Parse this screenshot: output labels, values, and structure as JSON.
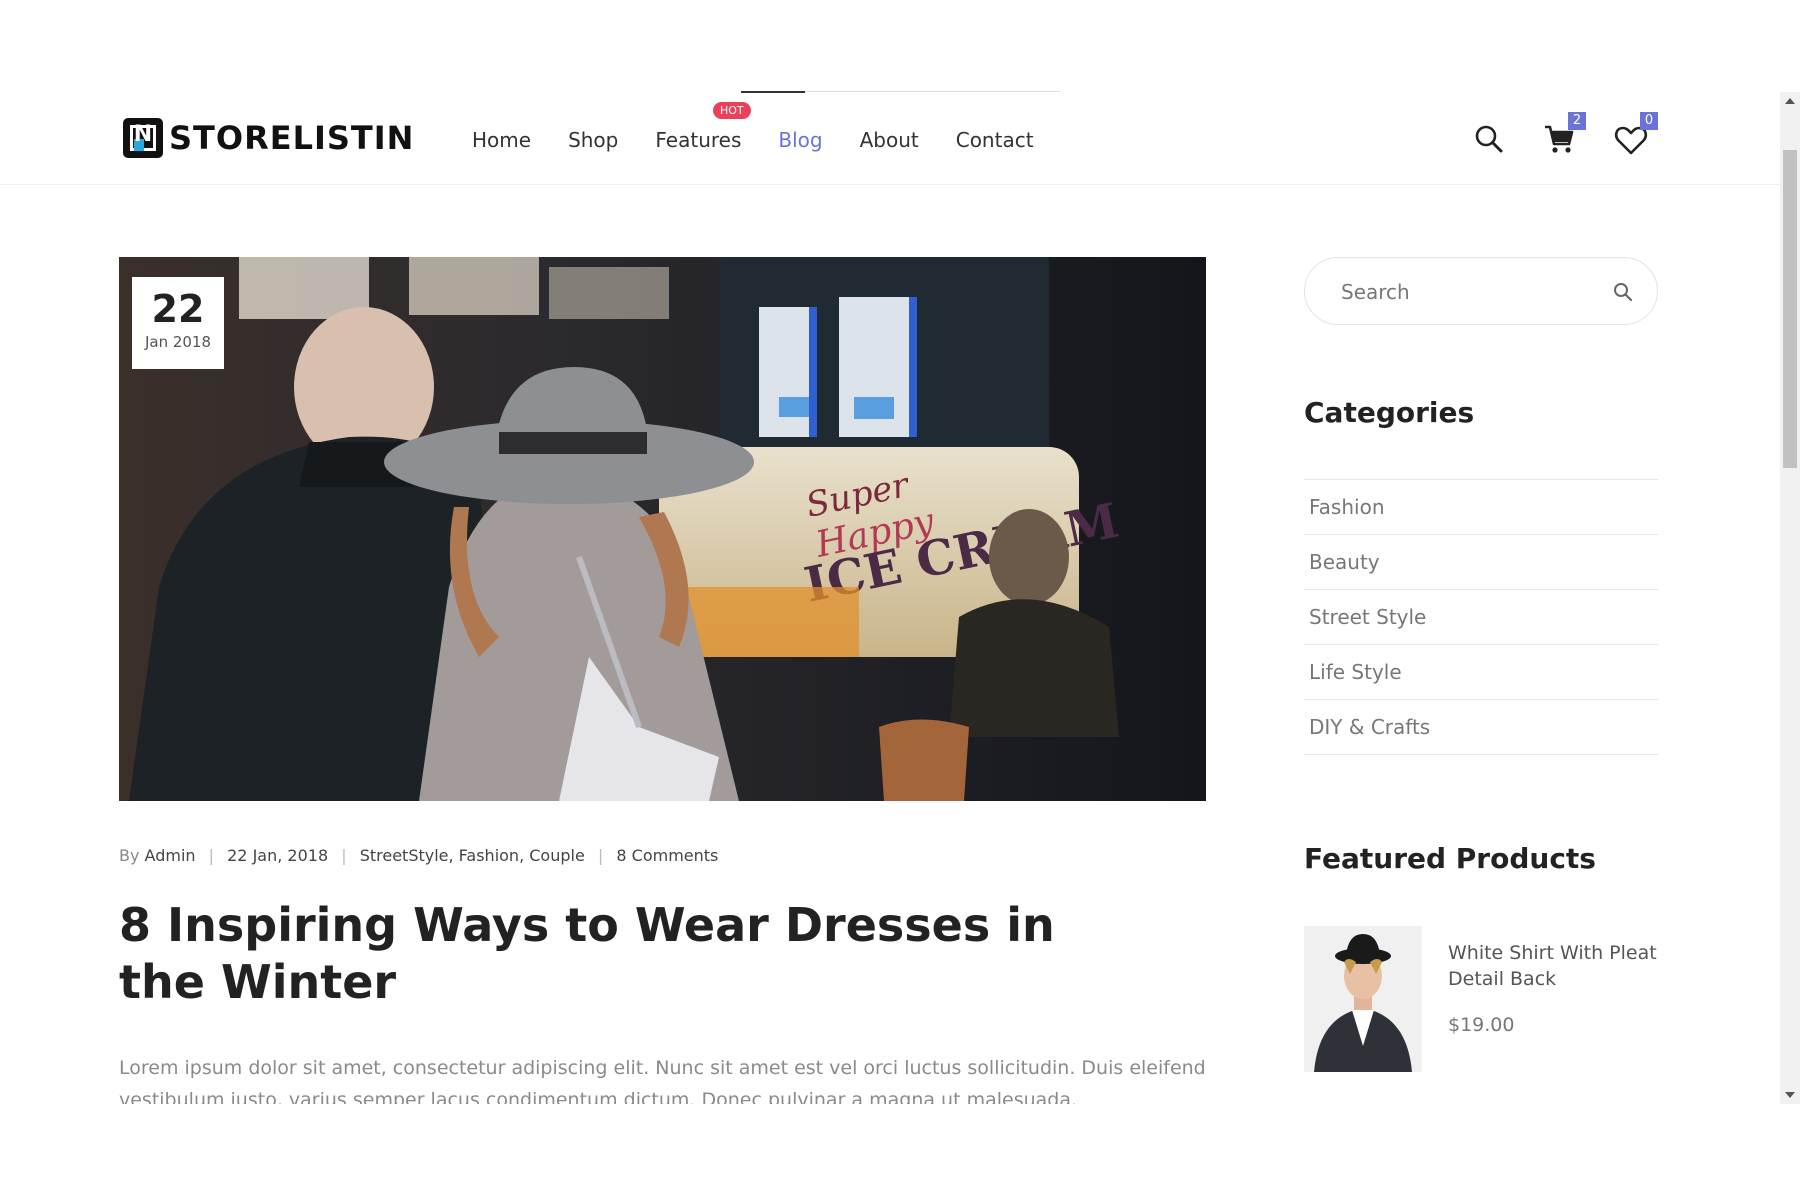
{
  "brand": {
    "name": "STORELISTIN",
    "logo_letter": "N"
  },
  "nav": {
    "items": [
      "Home",
      "Shop",
      "Features",
      "Blog",
      "About",
      "Contact"
    ],
    "active": "Blog",
    "hot_label": "HOT"
  },
  "header_icons": {
    "search": "search-icon",
    "cart": "cart-icon",
    "wishlist": "heart-icon",
    "cart_count": "2",
    "wishlist_count": "0"
  },
  "post": {
    "date_day": "22",
    "date_month": "Jan 2018",
    "meta": {
      "by": "By",
      "author": "Admin",
      "date": "22 Jan, 2018",
      "tags": "StreetStyle, Fashion, Couple",
      "comments": "8 Comments"
    },
    "title": "8 Inspiring Ways to Wear Dresses in the Winter",
    "excerpt": "Lorem ipsum dolor sit amet, consectetur adipiscing elit. Nunc sit amet est vel orci luctus sollicitudin. Duis eleifend vestibulum justo, varius semper lacus condimentum dictum. Donec pulvinar a magna ut malesuada."
  },
  "sidebar": {
    "search_placeholder": "Search",
    "categories_title": "Categories",
    "categories": [
      "Fashion",
      "Beauty",
      "Street Style",
      "Life Style",
      "DIY & Crafts"
    ],
    "featured_title": "Featured Products",
    "product": {
      "name": "White Shirt With Pleat Detail Back",
      "price": "$19.00"
    }
  },
  "colors": {
    "accent": "#6b73d8",
    "hot": "#ec3f59",
    "text_dark": "#222222",
    "text_muted": "#777777"
  }
}
